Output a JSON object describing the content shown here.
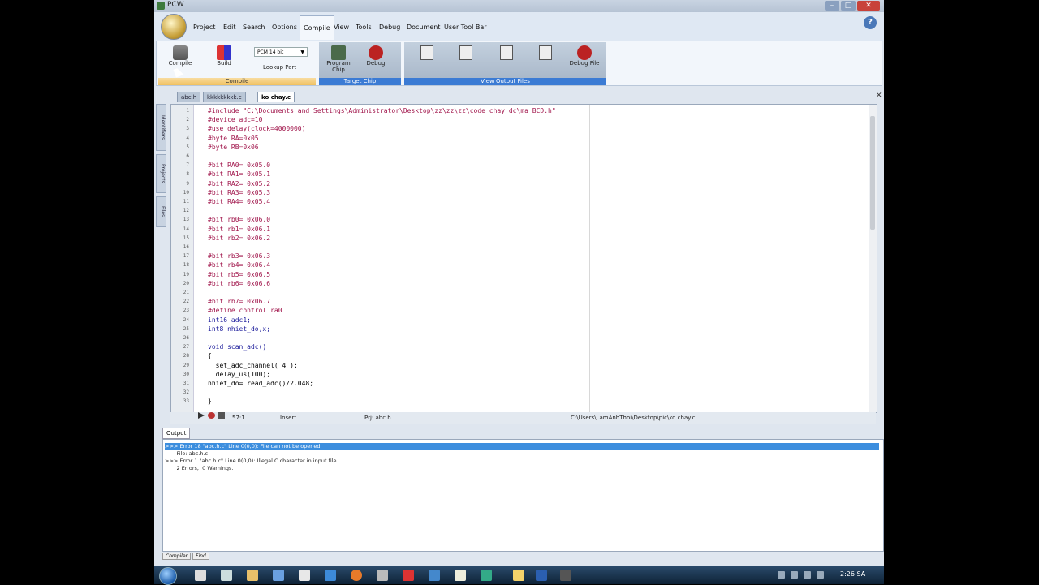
{
  "window": {
    "title": "PCW"
  },
  "menu": {
    "items": [
      "Project",
      "Edit",
      "Search",
      "Options",
      "Compile",
      "View",
      "Tools",
      "Debug",
      "Document",
      "User Tool Bar"
    ],
    "active": "Compile"
  },
  "ribbon": {
    "compile_group": {
      "label": "Compile",
      "compile_button": "Compile",
      "build_button": "Build",
      "selector_value": "PCM 14 bit",
      "lookup_button": "Lookup Part"
    },
    "target_group": {
      "label": "Target Chip",
      "program_chip": "Program Chip",
      "debug": "Debug"
    },
    "view_group": {
      "label": "View Output Files",
      "debug_file": "Debug File"
    }
  },
  "tabs": [
    {
      "label": "abc.h",
      "active": false
    },
    {
      "label": "kkkkkkkkk.c",
      "active": false
    },
    {
      "label": "ko chay.c",
      "active": true
    }
  ],
  "side_tabs": [
    "Identifiers",
    "Projects",
    "Files"
  ],
  "editor": {
    "lines": [
      {
        "n": "1",
        "t": "#include \"C:\\Documents and Settings\\Administrator\\Desktop\\zz\\zz\\zz\\code chay dc\\ma_BCD.h\""
      },
      {
        "n": "2",
        "t": "#device adc=10"
      },
      {
        "n": "3",
        "t": "#use delay(clock=4000000)"
      },
      {
        "n": "4",
        "t": "#byte RA=0x05"
      },
      {
        "n": "5",
        "t": "#byte RB=0x06"
      },
      {
        "n": "6",
        "t": ""
      },
      {
        "n": "7",
        "t": "#bit RA0= 0x05.0"
      },
      {
        "n": "8",
        "t": "#bit RA1= 0x05.1"
      },
      {
        "n": "9",
        "t": "#bit RA2= 0x05.2"
      },
      {
        "n": "10",
        "t": "#bit RA3= 0x05.3"
      },
      {
        "n": "11",
        "t": "#bit RA4= 0x05.4"
      },
      {
        "n": "12",
        "t": ""
      },
      {
        "n": "13",
        "t": "#bit rb0= 0x06.0"
      },
      {
        "n": "14",
        "t": "#bit rb1= 0x06.1"
      },
      {
        "n": "15",
        "t": "#bit rb2= 0x06.2"
      },
      {
        "n": "16",
        "t": ""
      },
      {
        "n": "17",
        "t": "#bit rb3= 0x06.3"
      },
      {
        "n": "18",
        "t": "#bit rb4= 0x06.4"
      },
      {
        "n": "19",
        "t": "#bit rb5= 0x06.5"
      },
      {
        "n": "20",
        "t": "#bit rb6= 0x06.6"
      },
      {
        "n": "21",
        "t": ""
      },
      {
        "n": "22",
        "t": "#bit rb7= 0x06.7"
      },
      {
        "n": "23",
        "t": "#define control ra0"
      },
      {
        "n": "24",
        "t": "int16 adc1;"
      },
      {
        "n": "25",
        "t": "int8 nhiet_do,x;"
      },
      {
        "n": "26",
        "t": ""
      },
      {
        "n": "27",
        "t": "void scan_adc()"
      },
      {
        "n": "28",
        "t": "{"
      },
      {
        "n": "29",
        "t": "  set_adc_channel( 4 );"
      },
      {
        "n": "30",
        "t": "  delay_us(100);"
      },
      {
        "n": "31",
        "t": "nhiet_do= read_adc()/2.048;"
      },
      {
        "n": "32",
        "t": ""
      },
      {
        "n": "33",
        "t": "}"
      }
    ]
  },
  "status": {
    "position": "57:1",
    "mode": "Insert",
    "project": "Prj: abc.h",
    "path": "C:\\Users\\LamAnhThoi\\Desktop\\pic\\ko chay.c"
  },
  "output": {
    "tab": "Output",
    "lines": [
      ">>> Error 18 \"abc.h.c\" Line 0(0,0): File can not be opened",
      "       File: abc.h.c",
      ">>> Error 1 \"abc.h.c\" Line 0(0,0): Illegal C character in input file",
      "       2 Errors,  0 Warnings."
    ],
    "bottom_tabs": [
      "Compiler",
      "Find"
    ]
  },
  "taskbar": {
    "clock": "2:26 SA"
  }
}
